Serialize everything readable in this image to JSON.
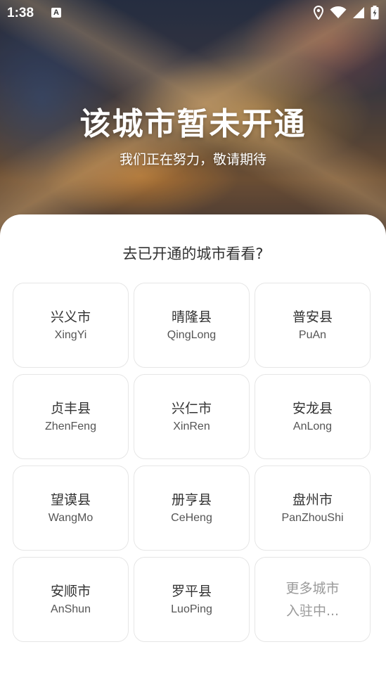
{
  "status_bar": {
    "time": "1:38",
    "notification_icon": "A",
    "icons": [
      "location-icon",
      "wifi-icon",
      "signal-icon",
      "battery-charging-icon"
    ]
  },
  "hero": {
    "title": "该城市暂未开通",
    "subtitle": "我们正在努力，敬请期待"
  },
  "sheet": {
    "heading": "去已开通的城市看看?",
    "cities": [
      {
        "name": "兴义市",
        "pinyin": "XingYi"
      },
      {
        "name": "晴隆县",
        "pinyin": "QingLong"
      },
      {
        "name": "普安县",
        "pinyin": "PuAn"
      },
      {
        "name": "贞丰县",
        "pinyin": "ZhenFeng"
      },
      {
        "name": "兴仁市",
        "pinyin": "XinRen"
      },
      {
        "name": "安龙县",
        "pinyin": "AnLong"
      },
      {
        "name": "望谟县",
        "pinyin": "WangMo"
      },
      {
        "name": "册亨县",
        "pinyin": "CeHeng"
      },
      {
        "name": "盘州市",
        "pinyin": "PanZhouShi"
      },
      {
        "name": "安顺市",
        "pinyin": "AnShun"
      },
      {
        "name": "罗平县",
        "pinyin": "LuoPing"
      }
    ],
    "more": {
      "line1": "更多城市",
      "line2": "入驻中..."
    }
  }
}
